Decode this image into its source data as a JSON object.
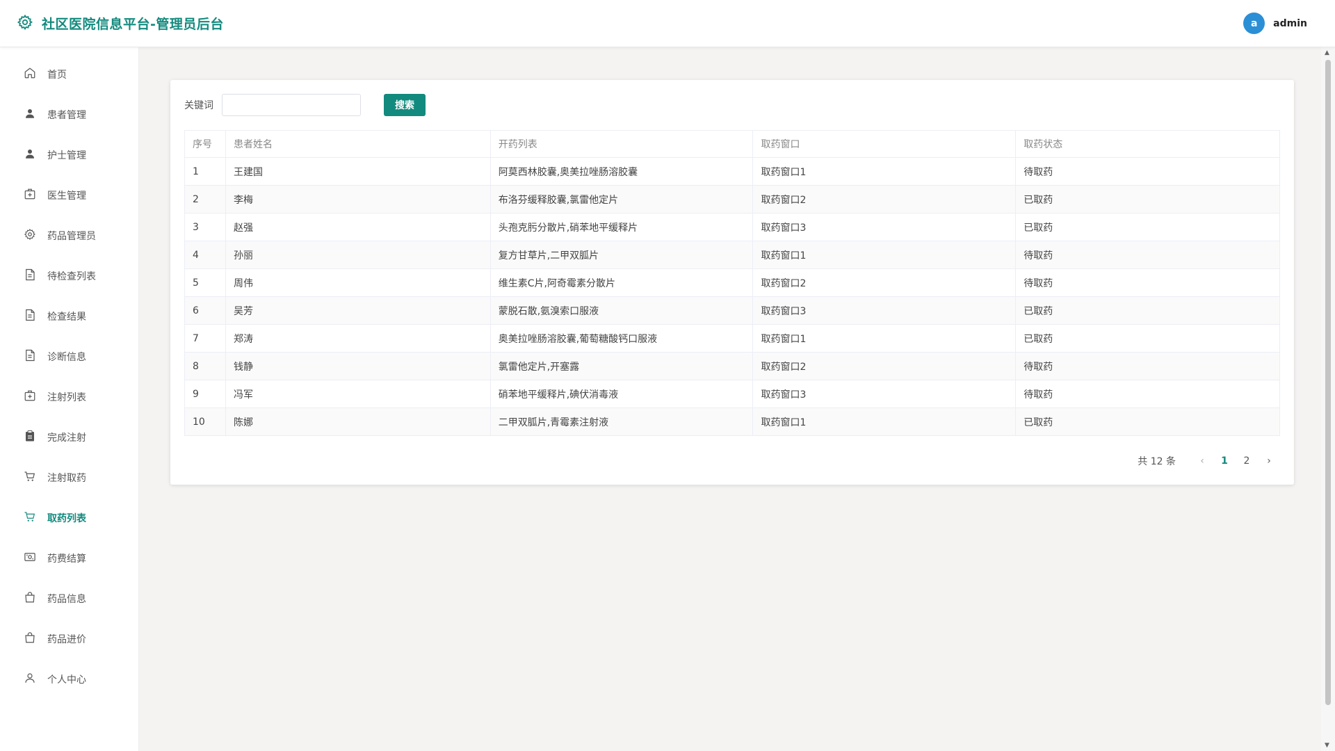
{
  "header": {
    "title": "社区医院信息平台-管理员后台",
    "avatar_letter": "a",
    "username": "admin",
    "brand_icon": "gear-icon"
  },
  "sidebar": {
    "items": [
      {
        "label": "首页",
        "icon": "home-icon",
        "active": false
      },
      {
        "label": "患者管理",
        "icon": "user-filled-icon",
        "active": false
      },
      {
        "label": "护士管理",
        "icon": "user-filled-icon",
        "active": false
      },
      {
        "label": "医生管理",
        "icon": "first-aid-icon",
        "active": false
      },
      {
        "label": "药品管理员",
        "icon": "gear-icon",
        "active": false
      },
      {
        "label": "待检查列表",
        "icon": "document-icon",
        "active": false
      },
      {
        "label": "检查结果",
        "icon": "document-icon",
        "active": false
      },
      {
        "label": "诊断信息",
        "icon": "document-icon",
        "active": false
      },
      {
        "label": "注射列表",
        "icon": "first-aid-icon",
        "active": false
      },
      {
        "label": "完成注射",
        "icon": "clipboard-icon",
        "active": false
      },
      {
        "label": "注射取药",
        "icon": "cart-icon",
        "active": false
      },
      {
        "label": "取药列表",
        "icon": "cart-icon",
        "active": true
      },
      {
        "label": "药费结算",
        "icon": "money-icon",
        "active": false
      },
      {
        "label": "药品信息",
        "icon": "bag-icon",
        "active": false
      },
      {
        "label": "药品进价",
        "icon": "bag-icon",
        "active": false
      },
      {
        "label": "个人中心",
        "icon": "user-outline-icon",
        "active": false
      }
    ]
  },
  "search": {
    "label": "关键词",
    "value": "",
    "placeholder": "",
    "button_label": "搜索"
  },
  "table": {
    "headers": [
      "序号",
      "患者姓名",
      "开药列表",
      "取药窗口",
      "取药状态"
    ],
    "rows": [
      [
        "1",
        "王建国",
        "阿莫西林胶囊,奥美拉唑肠溶胶囊",
        "取药窗口1",
        "待取药"
      ],
      [
        "2",
        "李梅",
        "布洛芬缓释胶囊,氯雷他定片",
        "取药窗口2",
        "已取药"
      ],
      [
        "3",
        "赵强",
        "头孢克肟分散片,硝苯地平缓释片",
        "取药窗口3",
        "已取药"
      ],
      [
        "4",
        "孙丽",
        "复方甘草片,二甲双胍片",
        "取药窗口1",
        "待取药"
      ],
      [
        "5",
        "周伟",
        "维生素C片,阿奇霉素分散片",
        "取药窗口2",
        "待取药"
      ],
      [
        "6",
        "吴芳",
        "蒙脱石散,氨溴索口服液",
        "取药窗口3",
        "已取药"
      ],
      [
        "7",
        "郑涛",
        "奥美拉唑肠溶胶囊,葡萄糖酸钙口服液",
        "取药窗口1",
        "已取药"
      ],
      [
        "8",
        "钱静",
        "氯雷他定片,开塞露",
        "取药窗口2",
        "待取药"
      ],
      [
        "9",
        "冯军",
        "硝苯地平缓释片,碘伏消毒液",
        "取药窗口3",
        "待取药"
      ],
      [
        "10",
        "陈娜",
        "二甲双胍片,青霉素注射液",
        "取药窗口1",
        "已取药"
      ]
    ]
  },
  "pagination": {
    "total_label": "共 12 条",
    "pages": [
      "1",
      "2"
    ],
    "current_page": "1",
    "prev_icon": "chevron-left-icon",
    "next_icon": "chevron-right-icon"
  },
  "colors": {
    "accent": "#138a7e",
    "avatar": "#2b8fd6"
  }
}
